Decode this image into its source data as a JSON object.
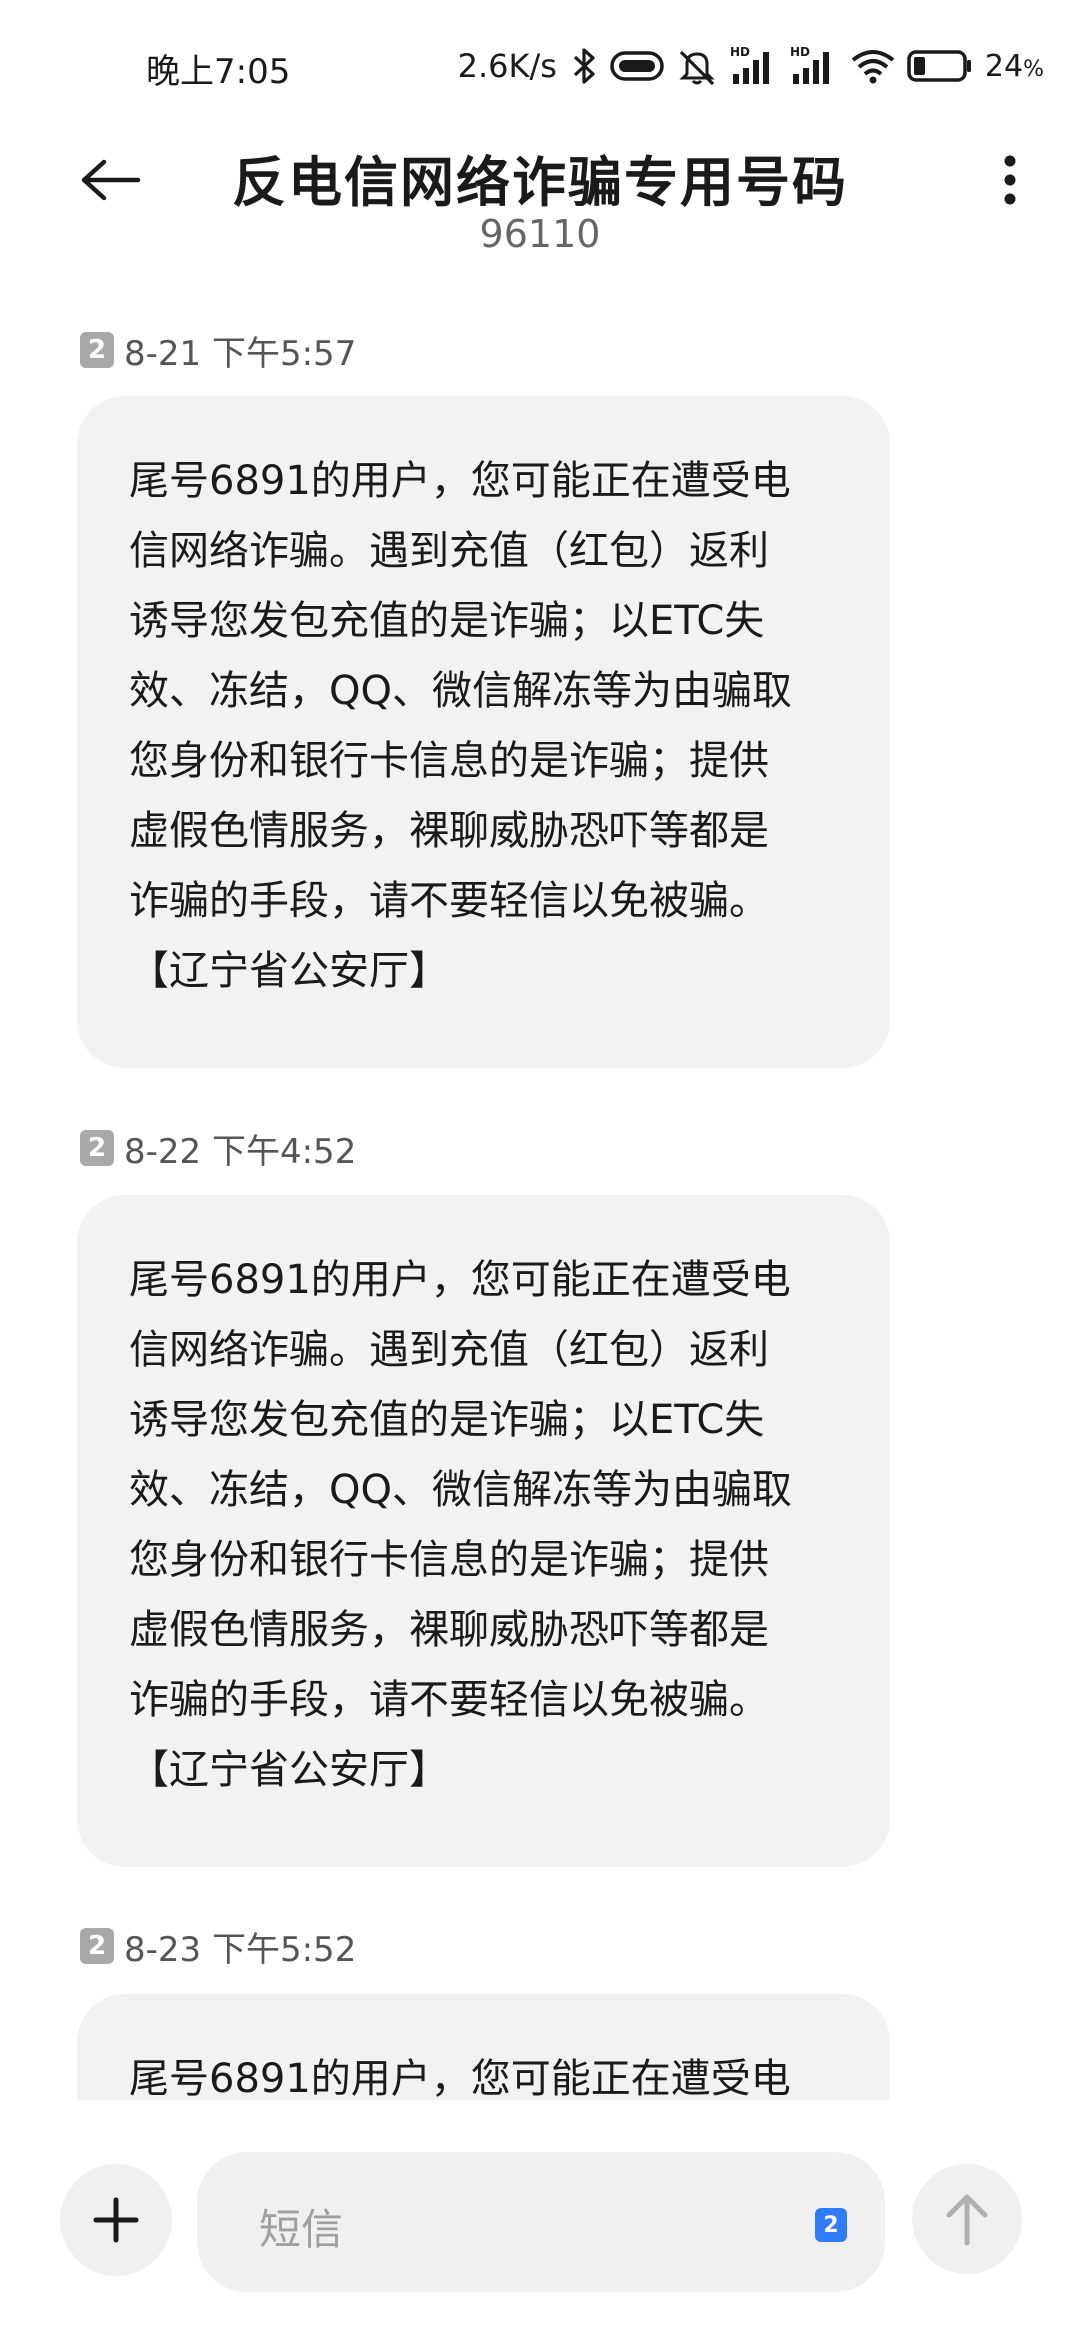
{
  "status_bar": {
    "time": "晚上7:05",
    "network_speed": "2.6K/s",
    "icons": [
      "bluetooth-icon",
      "vibrate-pill-icon",
      "mute-icon",
      "hd-signal-1-icon",
      "hd-signal-2-icon",
      "wifi-icon",
      "battery-icon"
    ],
    "hd_label_1": "HD",
    "hd_label_2": "HD",
    "battery_percent": "24",
    "battery_unit": "%",
    "battery_level": 0.24
  },
  "header": {
    "title": "反电信网络诈骗专用号码",
    "number": "96110",
    "back_icon": "back-arrow-icon",
    "more_icon": "more-vertical-icon"
  },
  "messages": [
    {
      "sim": "2",
      "timestamp": "8-21 下午5:57",
      "text": "尾号6891的用户，您可能正在遭受电\n信网络诈骗。遇到充值（红包）返利\n诱导您发包充值的是诈骗；以ETC失\n效、冻结，QQ、微信解冻等为由骗取\n您身份和银行卡信息的是诈骗；提供\n虚假色情服务，裸聊威胁恐吓等都是\n诈骗的手段，请不要轻信以免被骗。\n【辽宁省公安厅】"
    },
    {
      "sim": "2",
      "timestamp": "8-22 下午4:52",
      "text": "尾号6891的用户，您可能正在遭受电\n信网络诈骗。遇到充值（红包）返利\n诱导您发包充值的是诈骗；以ETC失\n效、冻结，QQ、微信解冻等为由骗取\n您身份和银行卡信息的是诈骗；提供\n虚假色情服务，裸聊威胁恐吓等都是\n诈骗的手段，请不要轻信以免被骗。\n【辽宁省公安厅】"
    },
    {
      "sim": "2",
      "timestamp": "8-23 下午5:52",
      "text": "尾号6891的用户，您可能正在遭受电"
    }
  ],
  "composer": {
    "placeholder": "短信",
    "sim_indicator": "2",
    "plus_icon": "plus-icon",
    "send_icon": "send-arrow-icon",
    "accent": "#2f7cf6"
  }
}
